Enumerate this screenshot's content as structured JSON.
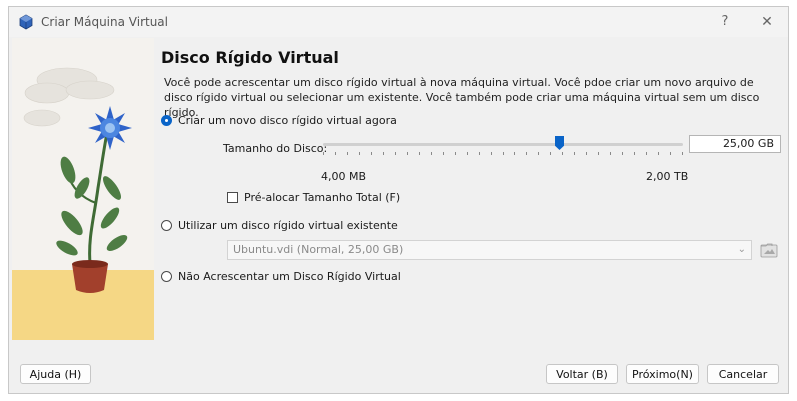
{
  "window": {
    "title": "Criar Máquina Virtual",
    "help_glyph": "?",
    "close_glyph": "✕"
  },
  "page": {
    "heading": "Disco Rígido Virtual",
    "description": "Você pode acrescentar um disco rígido virtual à nova máquina virtual. Você pdoe criar um novo arquivo de disco rígido virtual ou selecionar um existente. Você também pode criar uma máquina virtual sem um disco rígido."
  },
  "options": {
    "create_new": {
      "label": "Criar um novo disco rígido virtual agora",
      "selected": true
    },
    "disk_size": {
      "label": "Tamanho do Disco:",
      "value": "25,00 GB",
      "min_label": "4,00 MB",
      "max_label": "2,00 TB",
      "slider_fraction": 0.66
    },
    "preallocate": {
      "label": "Pré-alocar Tamanho Total (F)",
      "checked": false
    },
    "use_existing": {
      "label": "Utilizar um disco rígido virtual existente",
      "selected": false,
      "file_value": "Ubuntu.vdi (Normal, 25,00 GB)"
    },
    "no_disk": {
      "label": "Não Acrescentar um Disco Rígido Virtual",
      "selected": false
    }
  },
  "buttons": {
    "help": "Ajuda (H)",
    "back": "Voltar (B)",
    "next": "Próximo(N)",
    "cancel": "Cancelar"
  },
  "colors": {
    "accent": "#0a64c8",
    "dialog_bg": "#f0f0f0"
  }
}
